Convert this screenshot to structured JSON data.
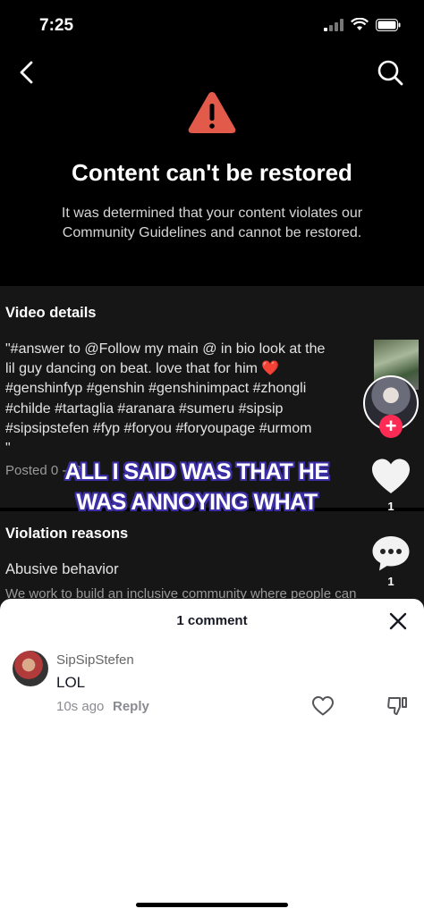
{
  "status_bar": {
    "time": "7:25"
  },
  "hero": {
    "title": "Content can't be restored",
    "description": "It was determined that your content violates our Community Guidelines and cannot be restored."
  },
  "video_details": {
    "heading": "Video details",
    "caption_lines": [
      "\"#answer to @Follow my main @ in bio look at the",
      "lil guy dancing on beat. love that for him ❤️",
      "#genshinfyp #genshin #genshinimpact #zhongli",
      "#childe #tartaglia #aranara #sumeru #sipsip",
      "#sipsipstefen #fyp #foryou #foryoupage #urmom",
      "\""
    ],
    "posted": "Posted 0   -18"
  },
  "violation": {
    "heading": "Violation reasons",
    "reason": "Abusive behavior",
    "reason_desc": "We work to build an inclusive community where people can"
  },
  "overlay": {
    "caption_line1": "ALL I SAID WAS THAT HE",
    "caption_line2": "WAS ANNOYING WHAT",
    "like_count": "1",
    "comment_count": "1"
  },
  "comments": {
    "title": "1 comment",
    "items": [
      {
        "user": "SipSipStefen",
        "text": "LOL",
        "time": "10s ago",
        "reply_label": "Reply"
      }
    ]
  },
  "colors": {
    "accent": "#fe2c55",
    "warning": "#e25a4a",
    "overlay_outline": "#3c2fa6"
  }
}
